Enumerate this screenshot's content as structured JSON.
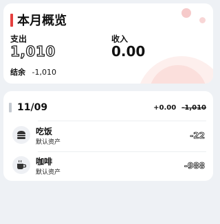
{
  "summary": {
    "title": "本月概览",
    "expense_label": "支出",
    "expense_value": "1,010",
    "income_label": "收入",
    "income_value": "0.00",
    "balance_label": "结余",
    "balance_value": "-1,010"
  },
  "day": {
    "date": "11/09",
    "income_total": "+0.00",
    "expense_total": "-1,010",
    "entries": [
      {
        "name": "吃饭",
        "account": "默认资产",
        "amount": "-22",
        "icon": "burger-icon"
      },
      {
        "name": "咖啡",
        "account": "默认资产",
        "amount": "-988",
        "icon": "coffee-cup-icon"
      }
    ]
  },
  "colors": {
    "accent": "#e5403f",
    "background": "#eef1f5",
    "card": "#ffffff",
    "decoration": "#fadad5"
  }
}
